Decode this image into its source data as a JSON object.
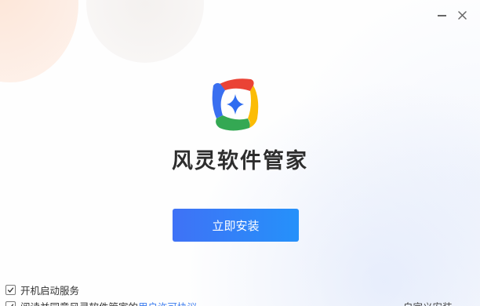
{
  "app": {
    "title": "风灵软件管家",
    "install_label": "立即安装"
  },
  "window_controls": {
    "minimize_icon": "minimize-icon",
    "close_icon": "close-icon"
  },
  "options": {
    "autostart_label": "开机启动服务",
    "autostart_checked": true,
    "agreement_prefix": "阅读并同意风灵软件管家的",
    "agreement_link": "用户许可协议",
    "agreement_checked": true,
    "custom_install_label": "自定义安装"
  },
  "colors": {
    "accent": "#2f80f8",
    "logo_red": "#ea4335",
    "logo_blue": "#3a6ff0",
    "logo_yellow": "#fbbc05",
    "logo_green": "#34a853",
    "star": "#2e6cf0",
    "link": "#3a7bef"
  }
}
